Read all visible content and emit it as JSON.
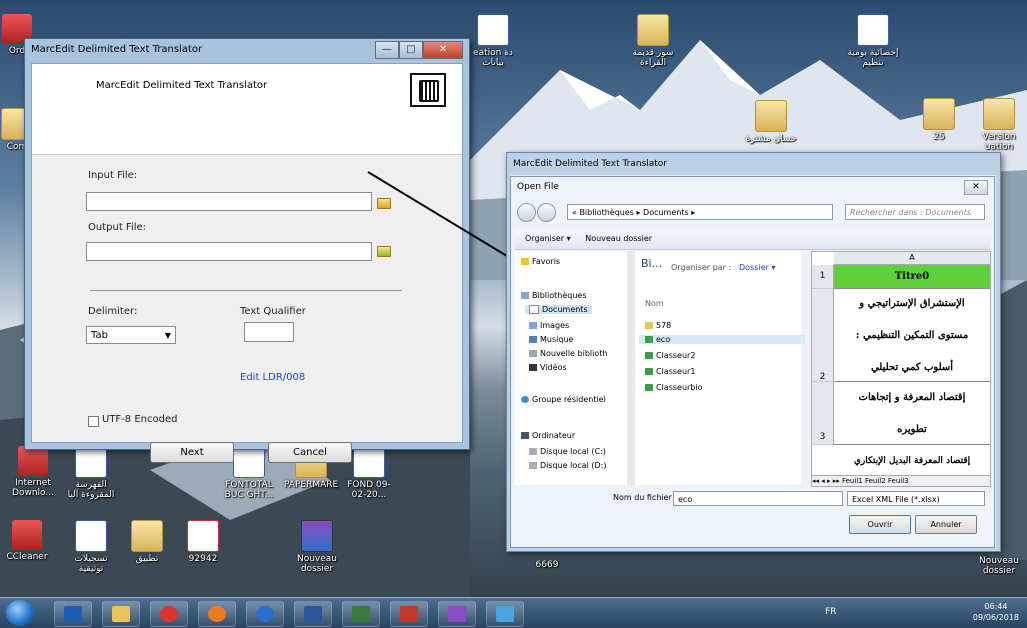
{
  "desktop": {
    "icons": [
      {
        "label": "Ord",
        "type": "app"
      },
      {
        "label": "Com",
        "type": "folder"
      },
      {
        "label": "Internet Downlo...",
        "type": "app"
      },
      {
        "label": "الفهرسة المقروءة آليا",
        "type": "word"
      },
      {
        "label": "FONTOTAL BUC GHT...",
        "type": "word"
      },
      {
        "label": "PAPERMARE",
        "type": "folder"
      },
      {
        "label": "FOND 09-02-20...",
        "type": "word"
      },
      {
        "label": "CCleaner",
        "type": "app"
      },
      {
        "label": "تسجيلات توثيقية",
        "type": "word"
      },
      {
        "label": "تطبيق",
        "type": "folder"
      },
      {
        "label": "92942",
        "type": "pdf"
      },
      {
        "label": "Nouveau dossier",
        "type": "rar"
      },
      {
        "label": "6669",
        "type": "folder"
      },
      {
        "label": "Nouveau dossier",
        "type": "folder"
      },
      {
        "label": "eation دة بيانات",
        "type": "word"
      },
      {
        "label": "سور قديمة القراءة",
        "type": "folder"
      },
      {
        "label": "إحصائية يومية تنظيم",
        "type": "word"
      },
      {
        "label": "حسان مشترة",
        "type": "folder"
      },
      {
        "label": "25",
        "type": "folder"
      },
      {
        "label": "Version uation",
        "type": "folder"
      }
    ]
  },
  "win1": {
    "title": "MarcEdit Delimited Text Translator",
    "min": "—",
    "max": "□",
    "close": "✕",
    "header_title": "MarcEdit Delimited Text Translator",
    "input_label": "Input File:",
    "output_label": "Output File:",
    "delimiter_label": "Delimiter:",
    "qualifier_label": "Text Qualifier",
    "delimiter_value": "Tab",
    "edit_link": "Edit LDR/008",
    "utf8_label": "UTF-8 Encoded",
    "next": "Next",
    "cancel": "Cancel"
  },
  "win2": {
    "title": "MarcEdit Delimited Text Translator"
  },
  "dialog": {
    "title": "Open File",
    "close": "✕",
    "address": "« Bibliothèques ▸ Documents ▸",
    "search_placeholder": "Rechercher dans : Documents",
    "organize": "Organiser ▾",
    "new_folder": "Nouveau dossier",
    "nav": [
      {
        "label": "Favoris"
      },
      {
        "label": "Bibliothèques"
      },
      {
        "label": "Documents"
      },
      {
        "label": "Images"
      },
      {
        "label": "Musique"
      },
      {
        "label": "Nouvelle biblioth"
      },
      {
        "label": "Vidéos"
      },
      {
        "label": "Groupe résidentiel"
      },
      {
        "label": "Ordinateur"
      },
      {
        "label": "Disque local (C:)"
      },
      {
        "label": "Disque local (D:)"
      }
    ],
    "list_header": "Bi...",
    "arrange_label": "Organiser par :",
    "arrange_value": "Dossier ▾",
    "col_name": "Nom",
    "files": [
      "578",
      "eco",
      "Classeur2",
      "Classeur1",
      "Classeurbio"
    ],
    "sheet": {
      "col": "A",
      "rows": [
        {
          "num": "1",
          "text": "Titre0"
        },
        {
          "num": "",
          "text": "الإستشراق الإستراتيجي و"
        },
        {
          "num": "",
          "text": "مستوى التمكين التنظيمي :"
        },
        {
          "num": "2",
          "text": "أسلوب كمي تحليلي"
        },
        {
          "num": "",
          "text": "إقتصاد المعرفة و إتجاهات"
        },
        {
          "num": "3",
          "text": "تطويره"
        },
        {
          "num": "",
          "text": "إقتصاد المعرفة البديل الإبتكاري"
        }
      ],
      "tabs": "◂◂ ◂ ▸ ▸▸  Feuil1  Feuil2  Feuil3"
    },
    "filename_label": "Nom du fichier :",
    "filename_value": "eco",
    "filetype": "Excel XML File (*.xlsx)",
    "open": "Ouvrir",
    "cancel": "Annuler"
  },
  "taskbar": {
    "lang": "FR",
    "time": "06:44",
    "date": "09/06/2018"
  },
  "colors": {
    "accent": "#2244cc",
    "excel_green": "#5fcf3a"
  }
}
